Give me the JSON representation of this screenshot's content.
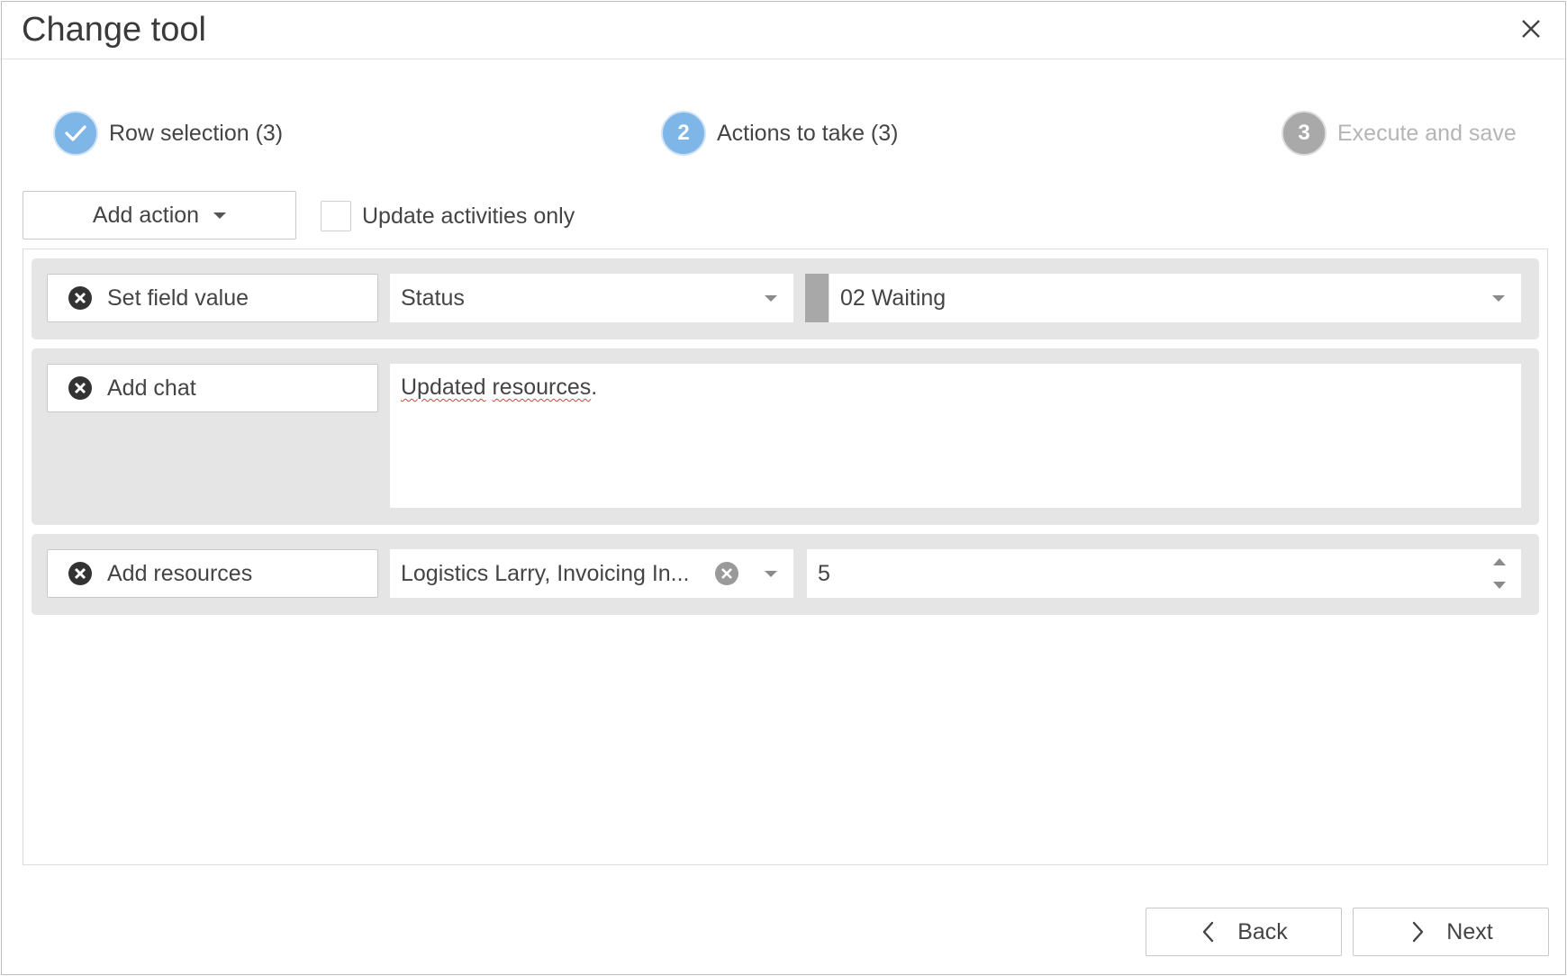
{
  "dialog": {
    "title": "Change tool"
  },
  "steps": [
    {
      "label": "Row selection (3)",
      "state": "done",
      "icon": "check-icon"
    },
    {
      "label": "Actions to take (3)",
      "state": "active",
      "number": "2"
    },
    {
      "label": "Execute and save",
      "state": "inactive",
      "number": "3"
    }
  ],
  "toolbar": {
    "add_action_label": "Add action",
    "update_activities_label": "Update activities only",
    "update_activities_checked": false
  },
  "actions": [
    {
      "type_label": "Set field value",
      "field": "Status",
      "value": "02 Waiting",
      "swatch_color": "#a8a8a8"
    },
    {
      "type_label": "Add chat",
      "text_word1": "Updated",
      "text_space": " ",
      "text_word2": "resources",
      "text_end": "."
    },
    {
      "type_label": "Add resources",
      "resources": "Logistics Larry, Invoicing In...",
      "quantity": "5"
    }
  ],
  "footer": {
    "back_label": "Back",
    "next_label": "Next"
  },
  "colors": {
    "accent": "#7fb6e8",
    "step_inactive": "#a9a9a9",
    "row_background": "#e5e5e5"
  }
}
